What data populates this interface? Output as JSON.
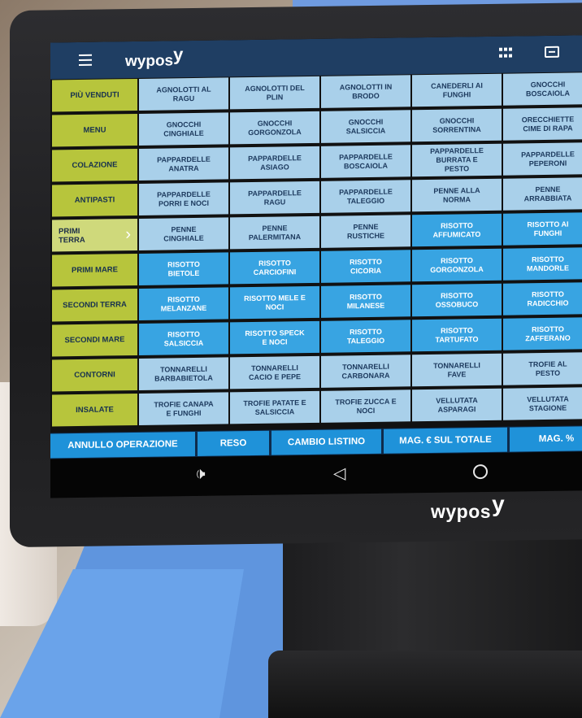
{
  "app": {
    "logo": "wypos",
    "logo_mark": "y"
  },
  "bezel": {
    "logo": "wypos",
    "logo_mark": "y"
  },
  "icons": {
    "menu": "hamburger-menu-icon",
    "grid": "grid-icon",
    "card": "card-icon",
    "more": "more-icon"
  },
  "colors": {
    "appbar": "#1f3e63",
    "category": "#b7c53c",
    "category_active": "#cfd97b",
    "product_light": "#a9d0ea",
    "product_dark": "#38a4e2",
    "action": "#1f92d9"
  },
  "categories": [
    "PIÙ VENDUTI",
    "MENU",
    "COLAZIONE",
    "ANTIPASTI",
    "PRIMI TERRA",
    "PRIMI MARE",
    "SECONDI TERRA",
    "SECONDI MARE",
    "CONTORNI",
    "INSALATE"
  ],
  "active_category": "PRIMI TERRA",
  "products": [
    [
      "AGNOLOTTI AL\nRAGU",
      "AGNOLOTTI DEL\nPLIN",
      "AGNOLOTTI IN\nBRODO",
      "CANEDERLI AI\nFUNGHI",
      "GNOCCHI\nBOSCAIOLA"
    ],
    [
      "GNOCCHI\nCINGHIALE",
      "GNOCCHI\nGORGONZOLA",
      "GNOCCHI\nSALSICCIA",
      "GNOCCHI\nSORRENTINA",
      "ORECCHIETTE\nCIME DI RAPA"
    ],
    [
      "PAPPARDELLE\nANATRA",
      "PAPPARDELLE\nASIAGO",
      "PAPPARDELLE\nBOSCAIOLA",
      "PAPPARDELLE\nBURRATA E\nPESTO",
      "PAPPARDELLE\nPEPERONI"
    ],
    [
      "PAPPARDELLE\nPORRI E NOCI",
      "PAPPARDELLE\nRAGU",
      "PAPPARDELLE\nTALEGGIO",
      "PENNE ALLA\nNORMA",
      "PENNE\nARRABBIATA"
    ],
    [
      "PENNE\nCINGHIALE",
      "PENNE\nPALERMITANA",
      "PENNE\nRUSTICHE",
      "RISOTTO\nAFFUMICATO",
      "RISOTTO AI\nFUNGHI"
    ],
    [
      "RISOTTO\nBIETOLE",
      "RISOTTO\nCARCIOFINI",
      "RISOTTO\nCICORIA",
      "RISOTTO\nGORGONZOLA",
      "RISOTTO\nMANDORLE"
    ],
    [
      "RISOTTO\nMELANZANE",
      "RISOTTO MELE E\nNOCI",
      "RISOTTO\nMILANESE",
      "RISOTTO\nOSSOBUCO",
      "RISOTTO\nRADICCHIO"
    ],
    [
      "RISOTTO\nSALSICCIA",
      "RISOTTO SPECK\nE NOCI",
      "RISOTTO\nTALEGGIO",
      "RISOTTO\nTARTUFATO",
      "RISOTTO\nZAFFERANO"
    ],
    [
      "TONNARELLI\nBARBABIETOLA",
      "TONNARELLI\nCACIO E PEPE",
      "TONNARELLI\nCARBONARA",
      "TONNARELLI\nFAVE",
      "TROFIE AL\nPESTO"
    ],
    [
      "TROFIE CANAPA\nE FUNGHI",
      "TROFIE PATATE E\nSALSICCIA",
      "TROFIE ZUCCA E\nNOCI",
      "VELLUTATA\nASPARAGI",
      "VELLUTATA\nSTAGIONE"
    ]
  ],
  "actions": [
    "ANNULLO OPERAZIONE",
    "RESO",
    "CAMBIO LISTINO",
    "MAG. € SUL TOTALE",
    "MAG. %"
  ],
  "navbar": {
    "volume_icon": "🕩",
    "back_icon": "◁"
  }
}
